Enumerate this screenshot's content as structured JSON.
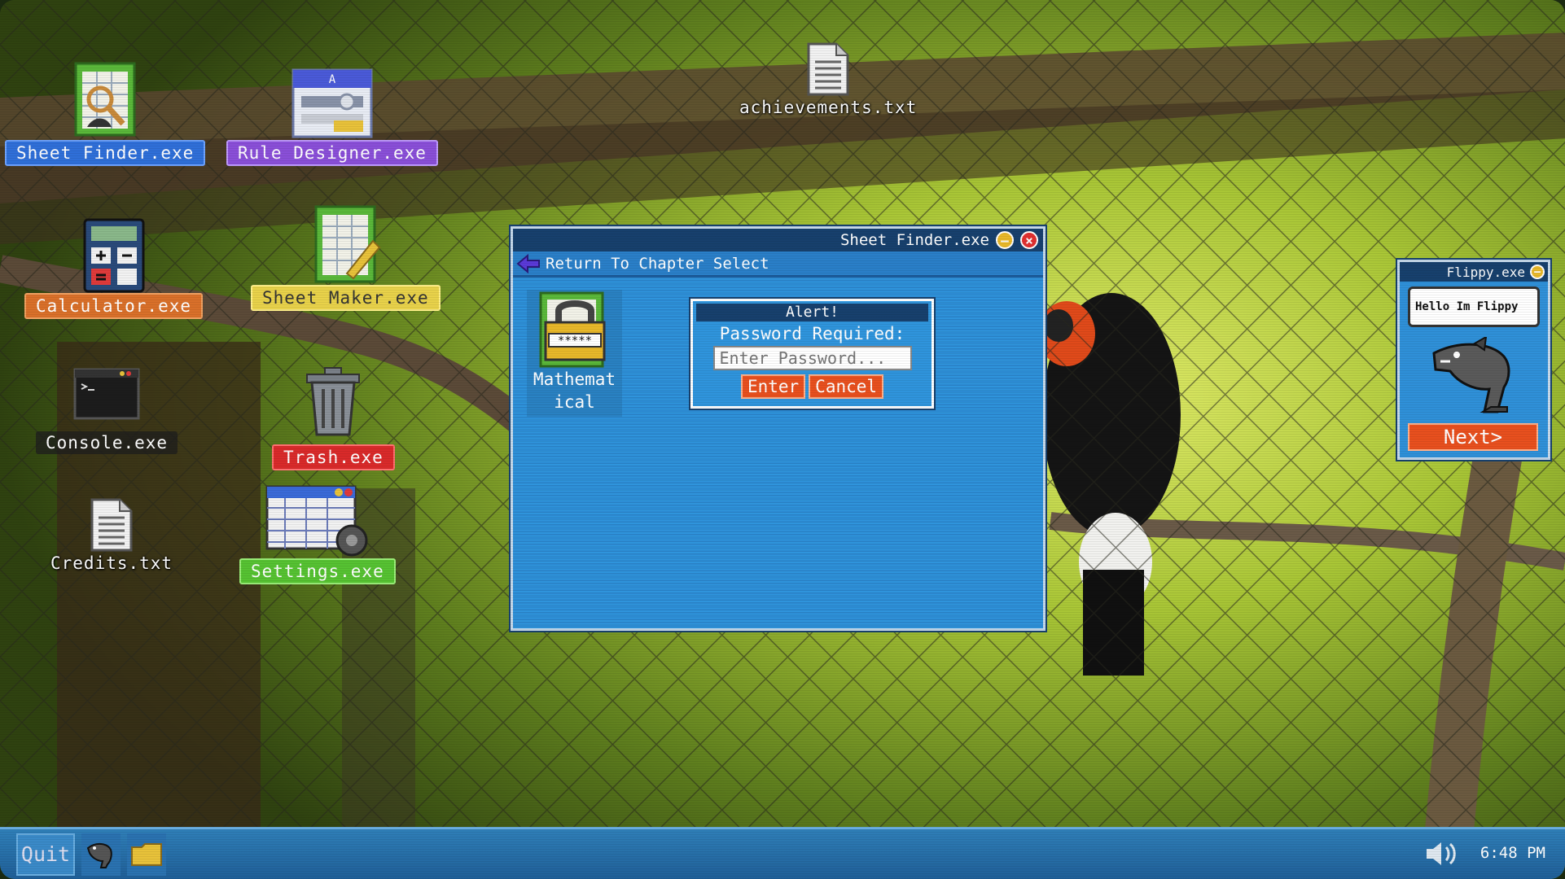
{
  "desktop": {
    "icons": [
      {
        "label": "Sheet Finder.exe",
        "icon": "sheet-finder-icon"
      },
      {
        "label": "Rule Designer.exe",
        "icon": "rule-designer-icon"
      },
      {
        "label": "achievements.txt",
        "icon": "text-file-icon"
      },
      {
        "label": "Calculator.exe",
        "icon": "calculator-icon"
      },
      {
        "label": "Sheet Maker.exe",
        "icon": "sheet-maker-icon"
      },
      {
        "label": "Console.exe",
        "icon": "console-icon"
      },
      {
        "label": "Trash.exe",
        "icon": "trash-icon"
      },
      {
        "label": "Credits.txt",
        "icon": "text-file-icon"
      },
      {
        "label": "Settings.exe",
        "icon": "settings-icon"
      }
    ]
  },
  "window": {
    "title": "Sheet Finder.exe",
    "nav_label": "Return To Chapter Select",
    "file": {
      "name": "Mathematical",
      "icon": "locked-sheet-icon"
    },
    "alert": {
      "title": "Alert!",
      "prompt": "Password Required:",
      "placeholder": "Enter Password...",
      "enter_label": "Enter",
      "cancel_label": "Cancel"
    }
  },
  "flippy": {
    "title": "Flippy.exe",
    "message": "Hello Im Flippy",
    "next_label": "Next>"
  },
  "taskbar": {
    "quit_label": "Quit",
    "clock": "6:48 PM"
  },
  "colors": {
    "window_blue": "#2f90d8",
    "title_navy": "#17406d",
    "button_orange": "#e8501e"
  }
}
